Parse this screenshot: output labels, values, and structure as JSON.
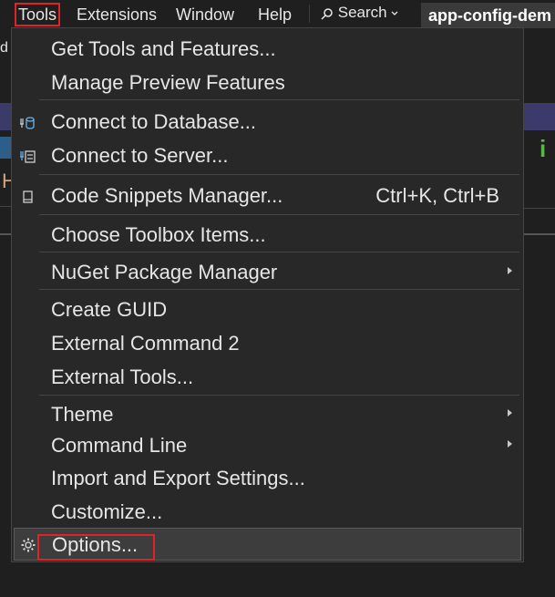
{
  "menubar": {
    "left_fragment": "",
    "items": [
      "Tools",
      "Extensions",
      "Window",
      "Help"
    ],
    "search_label": "Search",
    "app_title": "app-config-dem"
  },
  "background": {
    "left_letter": "d",
    "orange_letter": "H",
    "green_letter": "i"
  },
  "tools_menu": {
    "items": [
      {
        "label": "Get Tools and Features...",
        "icon": null
      },
      {
        "label": "Manage Preview Features",
        "icon": null
      },
      {
        "label": "Connect to Database...",
        "icon": "database-connect-icon"
      },
      {
        "label": "Connect to Server...",
        "icon": "server-connect-icon"
      },
      {
        "label": "Code Snippets Manager...",
        "icon": "snippet-icon",
        "shortcut": "Ctrl+K, Ctrl+B"
      },
      {
        "label": "Choose Toolbox Items...",
        "icon": null
      },
      {
        "label": "NuGet Package Manager",
        "icon": null,
        "submenu": true
      },
      {
        "label": "Create GUID",
        "icon": null
      },
      {
        "label": "External Command 2",
        "icon": null
      },
      {
        "label": "External Tools...",
        "icon": null
      },
      {
        "label": "Theme",
        "icon": null,
        "submenu": true
      },
      {
        "label": "Command Line",
        "icon": null,
        "submenu": true
      },
      {
        "label": "Import and Export Settings...",
        "icon": null
      },
      {
        "label": "Customize...",
        "icon": null
      },
      {
        "label": "Options...",
        "icon": "gear-icon",
        "selected": true
      }
    ]
  },
  "colors": {
    "highlight_red": "#e0222a",
    "menu_bg": "#282828",
    "selected_bg": "#3d3d3d"
  }
}
